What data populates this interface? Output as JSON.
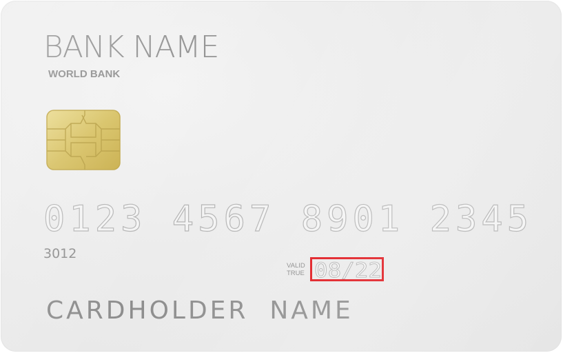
{
  "card": {
    "bank_name": "BANK NAME",
    "bank_subtitle": "WORLD BANK",
    "card_number": "0123 4567 8901 2345",
    "cvv_digits": "3012",
    "valid_label_line1": "VALID",
    "valid_label_line2": "TRUE",
    "expiry": "08/22",
    "cardholder": "CARDHOLDER  NAME"
  },
  "colors": {
    "card_background": "#ececec",
    "text_gray": "#8e8e8e",
    "chip_gold": "#d8c46a",
    "highlight_red": "#e0161c"
  },
  "icons": {
    "chip": "emv-chip-icon"
  }
}
